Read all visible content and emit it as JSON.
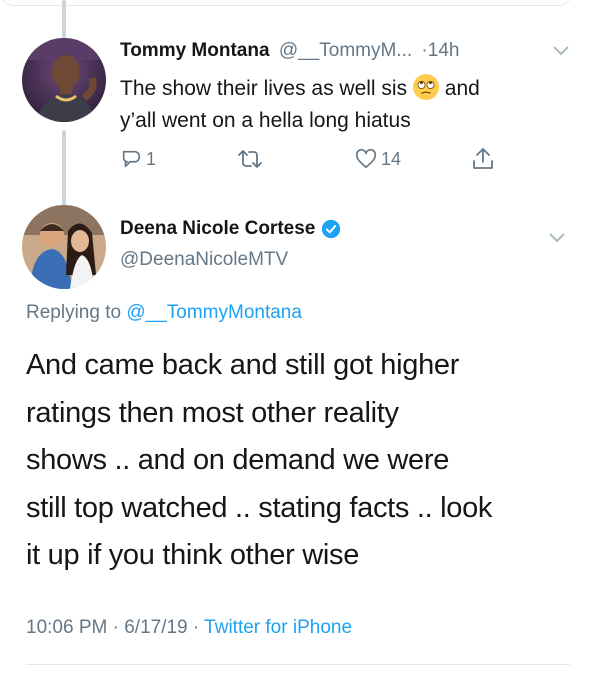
{
  "reply_tweet": {
    "display_name": "Tommy Montana",
    "handle": "@__TommyM...",
    "separator": "·",
    "time": "14h",
    "text_before_emoji": "The show their lives as well sis",
    "emoji": "🙄",
    "text_after_emoji": " and",
    "text_line2": "y’all went on a hella long hiatus",
    "reply_count": "1",
    "like_count": "14"
  },
  "main_tweet": {
    "display_name": "Deena Nicole Cortese",
    "handle": "@DeenaNicoleMTV",
    "replying_prefix": "Replying to",
    "replying_to": "@__TommyMontana",
    "body_lines": [
      "And came back and still got higher",
      "ratings then most other reality",
      "shows .. and on demand we were",
      "still top watched .. stating facts .. look",
      "it up if you think other wise"
    ],
    "timestamp_time": "10:06 PM",
    "dot1": "·",
    "timestamp_date": "6/17/19",
    "dot2": "·",
    "source": "Twitter for iPhone"
  },
  "icons": {
    "reply": "reply-icon",
    "retweet": "retweet-icon",
    "like": "heart-icon",
    "share": "share-icon",
    "verified": "verified-badge-icon",
    "menu": "chevron-down-icon"
  },
  "colors": {
    "link_blue": "#1da1f2",
    "muted_gray": "#657786",
    "text": "#14171a",
    "thread_line": "#ccd6dd"
  }
}
